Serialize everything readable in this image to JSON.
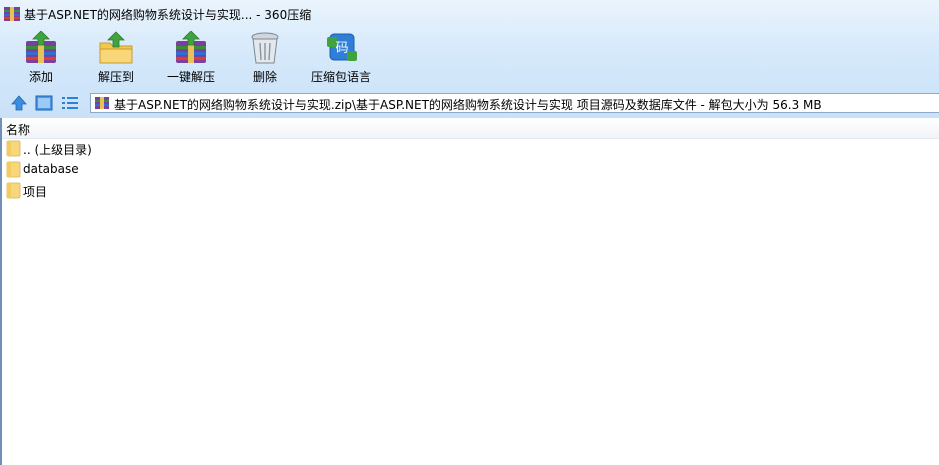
{
  "window": {
    "title": "基于ASP.NET的网络购物系统设计与实现... - 360压缩",
    "icon": "archive-app-icon"
  },
  "toolbar": {
    "buttons": [
      {
        "label": "添加",
        "icon": "add-archive-icon"
      },
      {
        "label": "解压到",
        "icon": "extract-to-icon"
      },
      {
        "label": "一键解压",
        "icon": "one-click-extract-icon"
      },
      {
        "label": "删除",
        "icon": "delete-trash-icon"
      },
      {
        "label": "压缩包语言",
        "icon": "archive-language-icon",
        "icon_text": "码"
      }
    ]
  },
  "navigation": {
    "up_icon": "up-arrow-icon",
    "view_icon": "view-mode-icon",
    "list_icon": "list-view-icon",
    "path": "基于ASP.NET的网络购物系统设计与实现.zip\\基于ASP.NET的网络购物系统设计与实现 项目源码及数据库文件 - 解包大小为 56.3 MB"
  },
  "file_list": {
    "column_name": "名称",
    "items": [
      {
        "name": ".. (上级目录)",
        "icon": "folder-icon"
      },
      {
        "name": "database",
        "icon": "folder-icon"
      },
      {
        "name": "项目",
        "icon": "folder-icon"
      }
    ]
  },
  "colors": {
    "chrome_top": "#eaf4fd",
    "chrome_bottom": "#c9e1f8",
    "folder_yellow": "#f7d77a",
    "accent_blue": "#2f7fd8"
  }
}
